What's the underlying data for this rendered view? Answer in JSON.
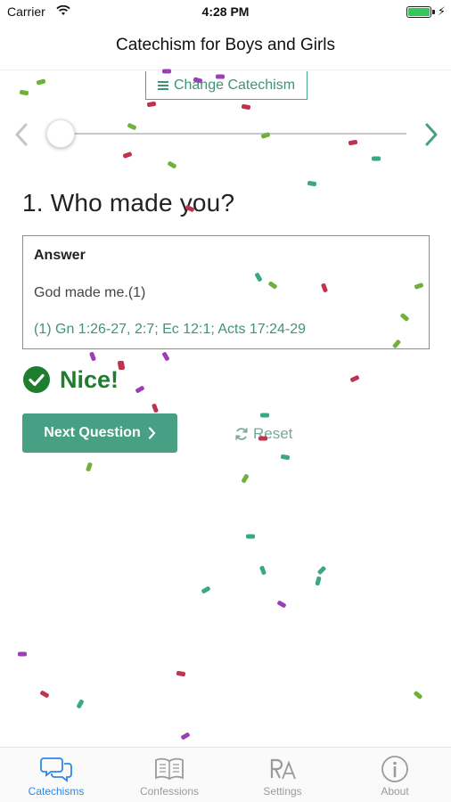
{
  "status_bar": {
    "carrier": "Carrier",
    "time": "4:28 PM"
  },
  "nav": {
    "title": "Catechism for Boys and Girls"
  },
  "controls": {
    "change_catechism": "Change Catechism",
    "slider_fraction": 0
  },
  "question": {
    "text": "1. Who made you?"
  },
  "answer": {
    "heading": "Answer",
    "text": "God made me.(1)",
    "references": "(1) Gn 1:26-27, 2:7; Ec 12:1; Acts 17:24-29"
  },
  "feedback": {
    "text": "Nice!"
  },
  "actions": {
    "next_label": "Next Question",
    "reset_label": "Reset"
  },
  "tabs": [
    {
      "label": "Catechisms",
      "icon": "chat-bubbles-icon",
      "active": true
    },
    {
      "label": "Confessions",
      "icon": "open-book-icon",
      "active": false
    },
    {
      "label": "Settings",
      "icon": "text-size-icon",
      "active": false
    },
    {
      "label": "About",
      "icon": "info-icon",
      "active": false
    }
  ],
  "colors": {
    "accent": "#47a083",
    "success": "#1f7d2e",
    "tab_active": "#2e86e6",
    "confetti": [
      "#c0334f",
      "#6fb13b",
      "#3aa886",
      "#9b3fb5"
    ]
  }
}
